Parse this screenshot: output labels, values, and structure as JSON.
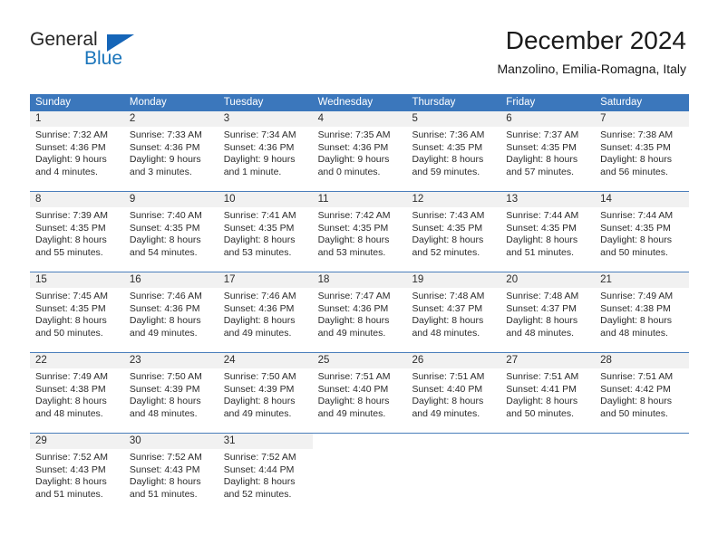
{
  "logo": {
    "text_primary": "General",
    "text_secondary": "Blue",
    "primary_color": "#262626",
    "secondary_color": "#1b75bb",
    "triangle_color": "#1565b8"
  },
  "header": {
    "title": "December 2024",
    "subtitle": "Manzolino, Emilia-Romagna, Italy"
  },
  "theme": {
    "header_bg": "#3b77bc",
    "header_text": "#ffffff",
    "day_band_bg": "#f1f1f1",
    "row_divider": "#4a7ebb"
  },
  "weekdays": [
    "Sunday",
    "Monday",
    "Tuesday",
    "Wednesday",
    "Thursday",
    "Friday",
    "Saturday"
  ],
  "weeks": [
    [
      {
        "day": "1",
        "sunrise": "Sunrise: 7:32 AM",
        "sunset": "Sunset: 4:36 PM",
        "daylight_line1": "Daylight: 9 hours",
        "daylight_line2": "and 4 minutes."
      },
      {
        "day": "2",
        "sunrise": "Sunrise: 7:33 AM",
        "sunset": "Sunset: 4:36 PM",
        "daylight_line1": "Daylight: 9 hours",
        "daylight_line2": "and 3 minutes."
      },
      {
        "day": "3",
        "sunrise": "Sunrise: 7:34 AM",
        "sunset": "Sunset: 4:36 PM",
        "daylight_line1": "Daylight: 9 hours",
        "daylight_line2": "and 1 minute."
      },
      {
        "day": "4",
        "sunrise": "Sunrise: 7:35 AM",
        "sunset": "Sunset: 4:36 PM",
        "daylight_line1": "Daylight: 9 hours",
        "daylight_line2": "and 0 minutes."
      },
      {
        "day": "5",
        "sunrise": "Sunrise: 7:36 AM",
        "sunset": "Sunset: 4:35 PM",
        "daylight_line1": "Daylight: 8 hours",
        "daylight_line2": "and 59 minutes."
      },
      {
        "day": "6",
        "sunrise": "Sunrise: 7:37 AM",
        "sunset": "Sunset: 4:35 PM",
        "daylight_line1": "Daylight: 8 hours",
        "daylight_line2": "and 57 minutes."
      },
      {
        "day": "7",
        "sunrise": "Sunrise: 7:38 AM",
        "sunset": "Sunset: 4:35 PM",
        "daylight_line1": "Daylight: 8 hours",
        "daylight_line2": "and 56 minutes."
      }
    ],
    [
      {
        "day": "8",
        "sunrise": "Sunrise: 7:39 AM",
        "sunset": "Sunset: 4:35 PM",
        "daylight_line1": "Daylight: 8 hours",
        "daylight_line2": "and 55 minutes."
      },
      {
        "day": "9",
        "sunrise": "Sunrise: 7:40 AM",
        "sunset": "Sunset: 4:35 PM",
        "daylight_line1": "Daylight: 8 hours",
        "daylight_line2": "and 54 minutes."
      },
      {
        "day": "10",
        "sunrise": "Sunrise: 7:41 AM",
        "sunset": "Sunset: 4:35 PM",
        "daylight_line1": "Daylight: 8 hours",
        "daylight_line2": "and 53 minutes."
      },
      {
        "day": "11",
        "sunrise": "Sunrise: 7:42 AM",
        "sunset": "Sunset: 4:35 PM",
        "daylight_line1": "Daylight: 8 hours",
        "daylight_line2": "and 53 minutes."
      },
      {
        "day": "12",
        "sunrise": "Sunrise: 7:43 AM",
        "sunset": "Sunset: 4:35 PM",
        "daylight_line1": "Daylight: 8 hours",
        "daylight_line2": "and 52 minutes."
      },
      {
        "day": "13",
        "sunrise": "Sunrise: 7:44 AM",
        "sunset": "Sunset: 4:35 PM",
        "daylight_line1": "Daylight: 8 hours",
        "daylight_line2": "and 51 minutes."
      },
      {
        "day": "14",
        "sunrise": "Sunrise: 7:44 AM",
        "sunset": "Sunset: 4:35 PM",
        "daylight_line1": "Daylight: 8 hours",
        "daylight_line2": "and 50 minutes."
      }
    ],
    [
      {
        "day": "15",
        "sunrise": "Sunrise: 7:45 AM",
        "sunset": "Sunset: 4:35 PM",
        "daylight_line1": "Daylight: 8 hours",
        "daylight_line2": "and 50 minutes."
      },
      {
        "day": "16",
        "sunrise": "Sunrise: 7:46 AM",
        "sunset": "Sunset: 4:36 PM",
        "daylight_line1": "Daylight: 8 hours",
        "daylight_line2": "and 49 minutes."
      },
      {
        "day": "17",
        "sunrise": "Sunrise: 7:46 AM",
        "sunset": "Sunset: 4:36 PM",
        "daylight_line1": "Daylight: 8 hours",
        "daylight_line2": "and 49 minutes."
      },
      {
        "day": "18",
        "sunrise": "Sunrise: 7:47 AM",
        "sunset": "Sunset: 4:36 PM",
        "daylight_line1": "Daylight: 8 hours",
        "daylight_line2": "and 49 minutes."
      },
      {
        "day": "19",
        "sunrise": "Sunrise: 7:48 AM",
        "sunset": "Sunset: 4:37 PM",
        "daylight_line1": "Daylight: 8 hours",
        "daylight_line2": "and 48 minutes."
      },
      {
        "day": "20",
        "sunrise": "Sunrise: 7:48 AM",
        "sunset": "Sunset: 4:37 PM",
        "daylight_line1": "Daylight: 8 hours",
        "daylight_line2": "and 48 minutes."
      },
      {
        "day": "21",
        "sunrise": "Sunrise: 7:49 AM",
        "sunset": "Sunset: 4:38 PM",
        "daylight_line1": "Daylight: 8 hours",
        "daylight_line2": "and 48 minutes."
      }
    ],
    [
      {
        "day": "22",
        "sunrise": "Sunrise: 7:49 AM",
        "sunset": "Sunset: 4:38 PM",
        "daylight_line1": "Daylight: 8 hours",
        "daylight_line2": "and 48 minutes."
      },
      {
        "day": "23",
        "sunrise": "Sunrise: 7:50 AM",
        "sunset": "Sunset: 4:39 PM",
        "daylight_line1": "Daylight: 8 hours",
        "daylight_line2": "and 48 minutes."
      },
      {
        "day": "24",
        "sunrise": "Sunrise: 7:50 AM",
        "sunset": "Sunset: 4:39 PM",
        "daylight_line1": "Daylight: 8 hours",
        "daylight_line2": "and 49 minutes."
      },
      {
        "day": "25",
        "sunrise": "Sunrise: 7:51 AM",
        "sunset": "Sunset: 4:40 PM",
        "daylight_line1": "Daylight: 8 hours",
        "daylight_line2": "and 49 minutes."
      },
      {
        "day": "26",
        "sunrise": "Sunrise: 7:51 AM",
        "sunset": "Sunset: 4:40 PM",
        "daylight_line1": "Daylight: 8 hours",
        "daylight_line2": "and 49 minutes."
      },
      {
        "day": "27",
        "sunrise": "Sunrise: 7:51 AM",
        "sunset": "Sunset: 4:41 PM",
        "daylight_line1": "Daylight: 8 hours",
        "daylight_line2": "and 50 minutes."
      },
      {
        "day": "28",
        "sunrise": "Sunrise: 7:51 AM",
        "sunset": "Sunset: 4:42 PM",
        "daylight_line1": "Daylight: 8 hours",
        "daylight_line2": "and 50 minutes."
      }
    ],
    [
      {
        "day": "29",
        "sunrise": "Sunrise: 7:52 AM",
        "sunset": "Sunset: 4:43 PM",
        "daylight_line1": "Daylight: 8 hours",
        "daylight_line2": "and 51 minutes."
      },
      {
        "day": "30",
        "sunrise": "Sunrise: 7:52 AM",
        "sunset": "Sunset: 4:43 PM",
        "daylight_line1": "Daylight: 8 hours",
        "daylight_line2": "and 51 minutes."
      },
      {
        "day": "31",
        "sunrise": "Sunrise: 7:52 AM",
        "sunset": "Sunset: 4:44 PM",
        "daylight_line1": "Daylight: 8 hours",
        "daylight_line2": "and 52 minutes."
      },
      {
        "day": "",
        "sunrise": "",
        "sunset": "",
        "daylight_line1": "",
        "daylight_line2": ""
      },
      {
        "day": "",
        "sunrise": "",
        "sunset": "",
        "daylight_line1": "",
        "daylight_line2": ""
      },
      {
        "day": "",
        "sunrise": "",
        "sunset": "",
        "daylight_line1": "",
        "daylight_line2": ""
      },
      {
        "day": "",
        "sunrise": "",
        "sunset": "",
        "daylight_line1": "",
        "daylight_line2": ""
      }
    ]
  ]
}
